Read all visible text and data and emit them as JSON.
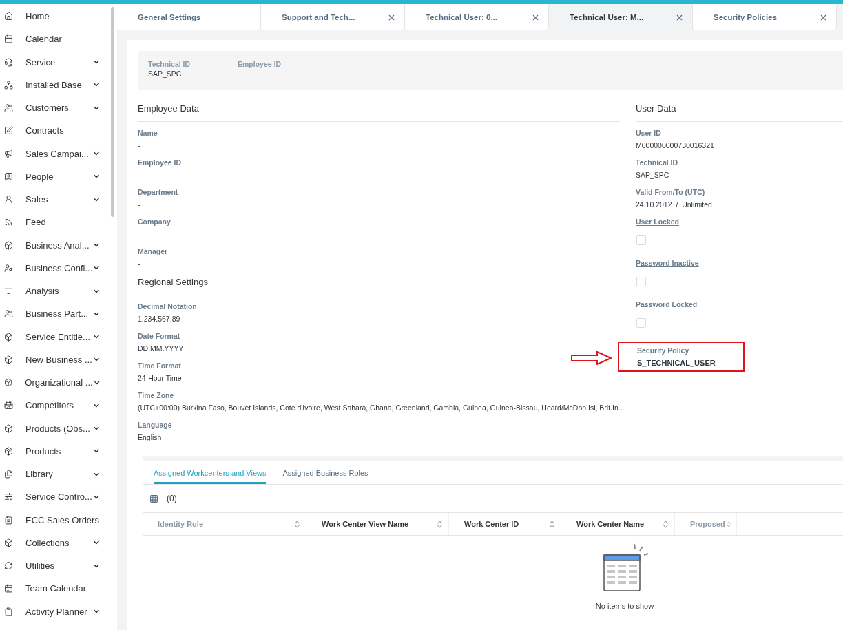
{
  "sidebar": {
    "items": [
      {
        "label": "Home",
        "expandable": false
      },
      {
        "label": "Calendar",
        "expandable": false
      },
      {
        "label": "Service",
        "expandable": true
      },
      {
        "label": "Installed Base",
        "expandable": true
      },
      {
        "label": "Customers",
        "expandable": true
      },
      {
        "label": "Contracts",
        "expandable": false
      },
      {
        "label": "Sales Campai...",
        "expandable": true
      },
      {
        "label": "People",
        "expandable": true
      },
      {
        "label": "Sales",
        "expandable": true
      },
      {
        "label": "Feed",
        "expandable": false
      },
      {
        "label": "Business Anal...",
        "expandable": true
      },
      {
        "label": "Business Confi...",
        "expandable": true
      },
      {
        "label": "Analysis",
        "expandable": true
      },
      {
        "label": "Business Part...",
        "expandable": true
      },
      {
        "label": "Service Entitle...",
        "expandable": true
      },
      {
        "label": "New Business ...",
        "expandable": true
      },
      {
        "label": "Organizational ...",
        "expandable": true
      },
      {
        "label": "Competitors",
        "expandable": true
      },
      {
        "label": "Products (Obs...",
        "expandable": true
      },
      {
        "label": "Products",
        "expandable": true
      },
      {
        "label": "Library",
        "expandable": true
      },
      {
        "label": "Service Contro...",
        "expandable": true
      },
      {
        "label": "ECC Sales Orders",
        "expandable": false
      },
      {
        "label": "Collections",
        "expandable": true
      },
      {
        "label": "Utilities",
        "expandable": true
      },
      {
        "label": "Team Calendar",
        "expandable": false
      },
      {
        "label": "Activity Planner",
        "expandable": true
      }
    ]
  },
  "tabs": [
    {
      "label": "General Settings",
      "selected": false,
      "closable": false
    },
    {
      "label": "Support and Tech...",
      "selected": false,
      "closable": true
    },
    {
      "label": "Technical User: 0...",
      "selected": false,
      "closable": true
    },
    {
      "label": "Technical User: M...",
      "selected": true,
      "closable": true
    },
    {
      "label": "Security Policies",
      "selected": false,
      "closable": true
    }
  ],
  "header": {
    "fields": [
      {
        "label": "Technical ID",
        "value": "SAP_SPC"
      },
      {
        "label": "Employee ID"
      }
    ]
  },
  "employee_data": {
    "title": "Employee Data",
    "fields": [
      {
        "label": "Name",
        "value": "-"
      },
      {
        "label": "Employee ID",
        "value": "-"
      },
      {
        "label": "Department",
        "value": "-"
      },
      {
        "label": "Company",
        "value": "-"
      },
      {
        "label": "Manager",
        "value": "-"
      }
    ]
  },
  "regional_settings": {
    "title": "Regional Settings",
    "fields": [
      {
        "label": "Decimal Notation",
        "value": "1.234.567,89"
      },
      {
        "label": "Date Format",
        "value": "DD.MM.YYYY"
      },
      {
        "label": "Time Format",
        "value": "24-Hour Time"
      },
      {
        "label": "Time Zone",
        "value": "(UTC+00:00) Burkina Faso, Bouvet Islands, Cote d'Ivoire, West Sahara, Ghana, Greenland, Gambia, Guinea, Guinea-Bissau, Heard/McDon.Isl, Brit.In..."
      },
      {
        "label": "Language",
        "value": "English"
      }
    ]
  },
  "user_data": {
    "title": "User Data",
    "fields": [
      {
        "kind": "text",
        "label": "User ID",
        "value": "M000000000730016321"
      },
      {
        "kind": "text",
        "label": "Technical ID",
        "value": "SAP_SPC"
      },
      {
        "kind": "range",
        "label": "Valid From/To (UTC)",
        "value": "24.10.2012",
        "separator": "/",
        "value_to": "Unlimited"
      },
      {
        "kind": "checkbox",
        "label": "User Locked",
        "checked": false
      },
      {
        "kind": "checkbox",
        "label": "Password Inactive",
        "checked": false
      },
      {
        "kind": "checkbox",
        "label": "Password Locked",
        "checked": false
      },
      {
        "kind": "text",
        "label": "Security Policy",
        "value": "S_TECHNICAL_USER",
        "highlighted": true
      }
    ]
  },
  "detail_tabs": [
    {
      "label": "Assigned Workcenters and Views",
      "selected": true
    },
    {
      "label": "Assigned Business Roles",
      "selected": false
    }
  ],
  "table": {
    "count": "(0)",
    "columns": [
      {
        "label": "Identity Role",
        "disabled": true
      },
      {
        "label": "Work Center View Name",
        "disabled": false
      },
      {
        "label": "Work Center ID",
        "disabled": false
      },
      {
        "label": "Work Center Name",
        "disabled": false
      },
      {
        "label": "Proposed",
        "disabled": true
      }
    ],
    "empty_text": "No items to show"
  }
}
